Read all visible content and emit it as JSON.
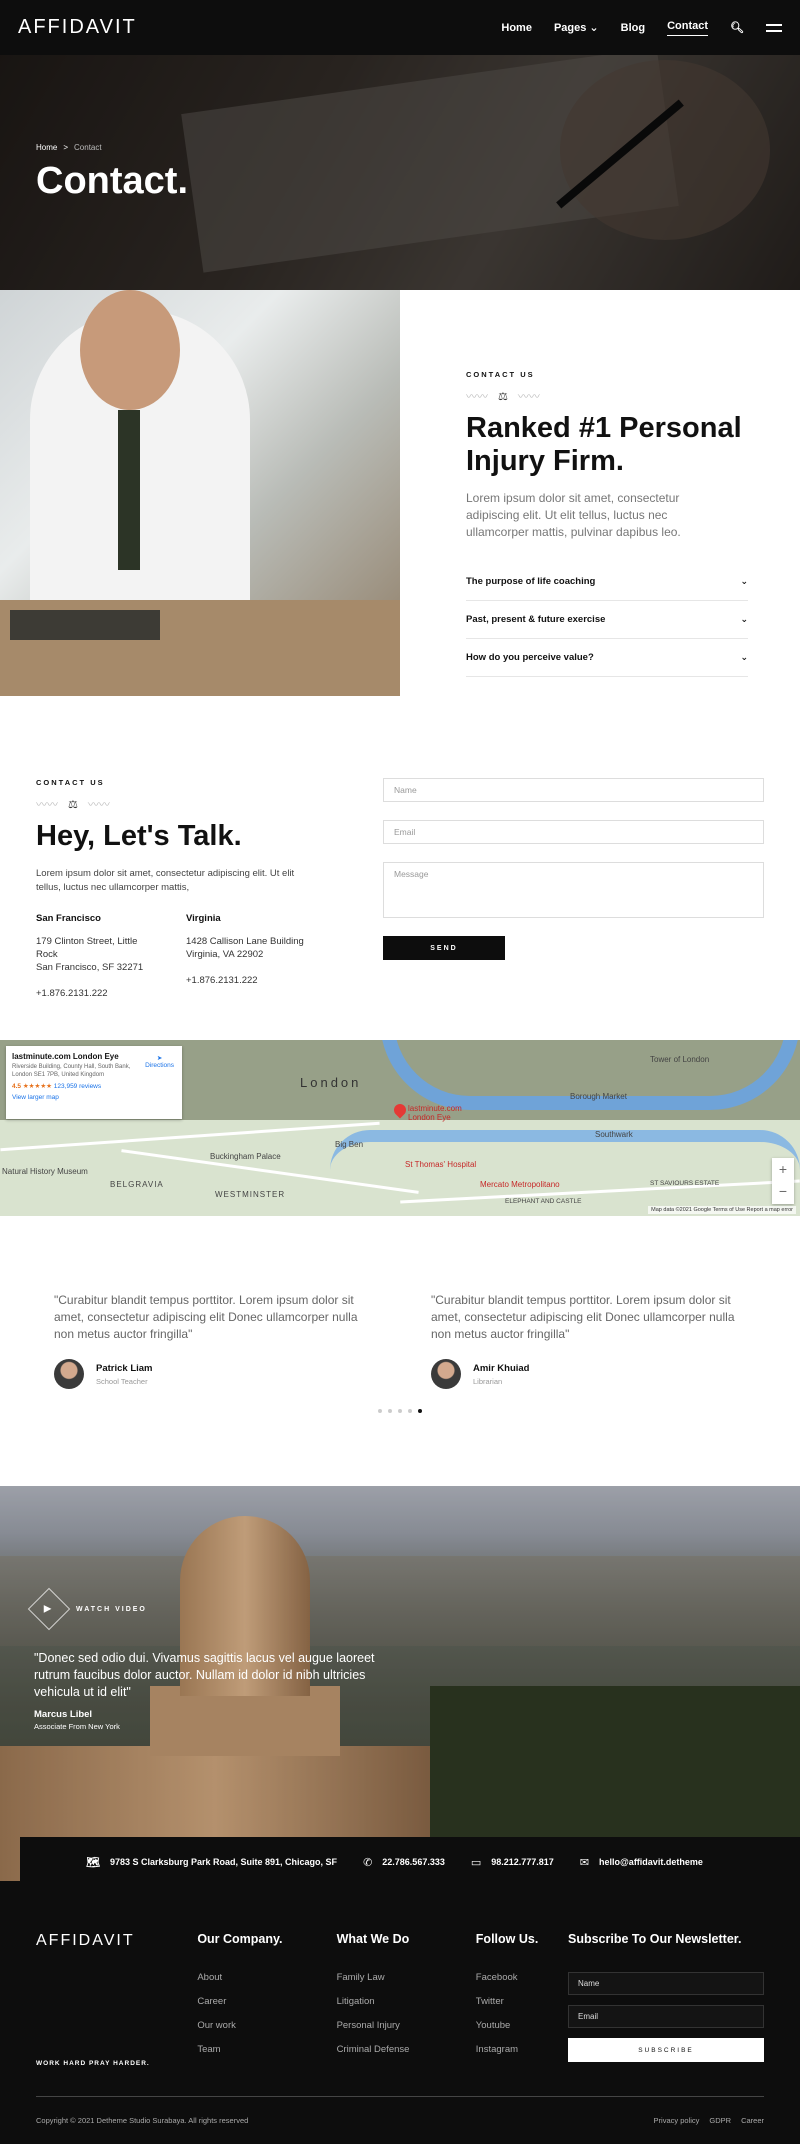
{
  "nav": {
    "logo": "AFFIDAVIT",
    "items": [
      {
        "label": "Home"
      },
      {
        "label": "Pages ⌄"
      },
      {
        "label": "Blog"
      },
      {
        "label": "Contact"
      }
    ]
  },
  "hero": {
    "breadcrumb_home": "Home",
    "breadcrumb_sep": ">",
    "breadcrumb_current": "Contact",
    "title": "Contact."
  },
  "ranked": {
    "eyebrow": "CONTACT US",
    "title_line1": "Ranked #1 Personal",
    "title_line2": "Injury Firm.",
    "lead": "Lorem ipsum dolor sit amet, consectetur adipiscing elit. Ut elit tellus, luctus nec ullamcorper mattis, pulvinar dapibus leo.",
    "accordion": [
      {
        "label": "The purpose of life coaching"
      },
      {
        "label": "Past, present & future exercise"
      },
      {
        "label": "How do you perceive value?"
      }
    ]
  },
  "contact": {
    "eyebrow": "CONTACT US",
    "title": "Hey, Let's Talk.",
    "lead": "Lorem ipsum dolor sit amet, consectetur adipiscing elit. Ut elit tellus, luctus nec ullamcorper mattis,",
    "offices": [
      {
        "city": "San Francisco",
        "line1": "179  Clinton Street, Little",
        "line2": "Rock",
        "line3": "San Francisco, SF 32271",
        "phone": "+1.876.2131.222"
      },
      {
        "city": "Virginia",
        "line1": "1428 Callison Lane Building",
        "line2": "Virginia, VA 22902",
        "line3": "",
        "phone": "+1.876.2131.222"
      }
    ],
    "form": {
      "name_placeholder": "Name",
      "email_placeholder": "Email",
      "message_placeholder": "Message",
      "send_label": "SEND"
    }
  },
  "map": {
    "place": "lastminute.com London Eye",
    "address": "Riverside Building, County Hall, South Bank, London SE1 7PB, United Kingdom",
    "rating": "4.5 ★★★★★",
    "reviews": "123,959 reviews",
    "directions": "Directions",
    "view_larger": "View larger map",
    "labels": {
      "london": "London",
      "buckingham": "Buckingham Palace",
      "westminster": "WESTMINSTER",
      "bigben": "Big Ben",
      "belgravia": "BELGRAVIA",
      "southwark": "Southwark",
      "pin": "lastminute.com London Eye",
      "stthomas": "St Thomas' Hospital",
      "metro": "Mercato Metropolitano",
      "tower": "Tower of London",
      "borough": "Borough Market",
      "elephant": "ELEPHANT AND CASTLE",
      "saviours": "ST SAVIOURS ESTATE",
      "museum": "Natural History Museum"
    },
    "zoom_in": "+",
    "zoom_out": "−",
    "footer": "Map data ©2021 Google   Terms of Use   Report a map error"
  },
  "testimonials": [
    {
      "quote": "\"Curabitur blandit tempus porttitor. Lorem ipsum dolor sit amet, consectetur adipiscing elit Donec ullamcorper nulla non metus auctor fringilla\"",
      "name": "Patrick Liam",
      "role": "School Teacher"
    },
    {
      "quote": "\"Curabitur blandit tempus porttitor. Lorem ipsum dolor sit amet, consectetur adipiscing elit Donec ullamcorper nulla non metus auctor fringilla\"",
      "name": "Amir Khuiad",
      "role": "Librarian"
    }
  ],
  "video": {
    "label": "WATCH VIDEO",
    "quote": "\"Donec sed odio dui. Vivamus sagittis lacus vel augue laoreet rutrum faucibus dolor auctor. Nullam id dolor id nibh ultricies vehicula ut id elit\"",
    "name": "Marcus Libel",
    "role": "Associate From New York"
  },
  "infobar": [
    {
      "icon": "map-icon",
      "text": "9783 S Clarksburg Park Road, Suite 891, Chicago, SF"
    },
    {
      "icon": "phone-icon",
      "text": "22.786.567.333"
    },
    {
      "icon": "chat-icon",
      "text": "98.212.777.817"
    },
    {
      "icon": "mail-icon",
      "text": "hello@affidavit.detheme"
    }
  ],
  "footer": {
    "logo": "AFFIDAVIT",
    "slogan": "WORK HARD PRAY HARDER.",
    "columns": [
      {
        "title": "Our Company.",
        "items": [
          "About",
          "Career",
          "Our work",
          "Team"
        ]
      },
      {
        "title": "What We Do",
        "items": [
          "Family Law",
          "Litigation",
          "Personal Injury",
          "Criminal Defense"
        ]
      },
      {
        "title": "Follow Us.",
        "items": [
          "Facebook",
          "Twitter",
          "Youtube",
          "Instagram"
        ]
      }
    ],
    "newsletter": {
      "title": "Subscribe To Our Newsletter.",
      "name_value": "Name",
      "email_value": "Email",
      "button": "SUBSCRIBE"
    },
    "copyright": "Copyright © 2021 Detheme Studio Surabaya. All rights reserved",
    "links": [
      "Privacy policy",
      "GDPR",
      "Career"
    ]
  }
}
